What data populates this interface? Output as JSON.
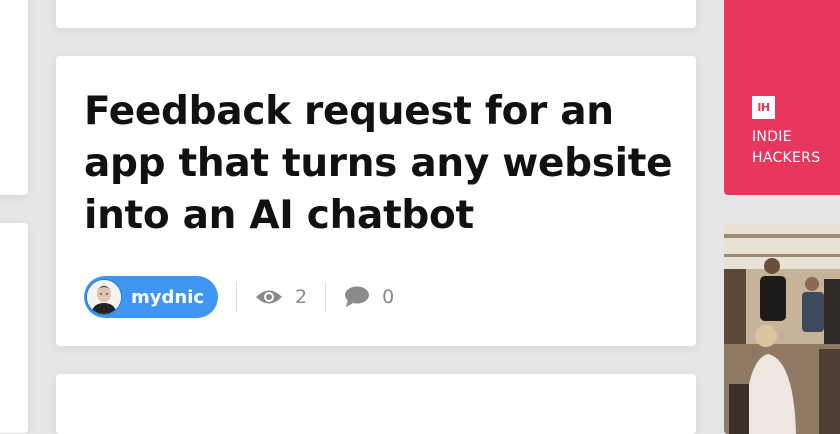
{
  "post": {
    "title": "Feedback request for an app that turns any website into an AI chatbot",
    "author": "mydnic",
    "views": "2",
    "comments": "0"
  },
  "sidebar_ad": {
    "logo_text": "IH",
    "line1": "INDIE",
    "line2": "HACKERS"
  },
  "colors": {
    "accent": "#3e95f2",
    "brand": "#e8365d",
    "page_bg": "#e6e6e6"
  },
  "icons": {
    "views": "eye-icon",
    "comments": "speech-bubble-icon"
  }
}
